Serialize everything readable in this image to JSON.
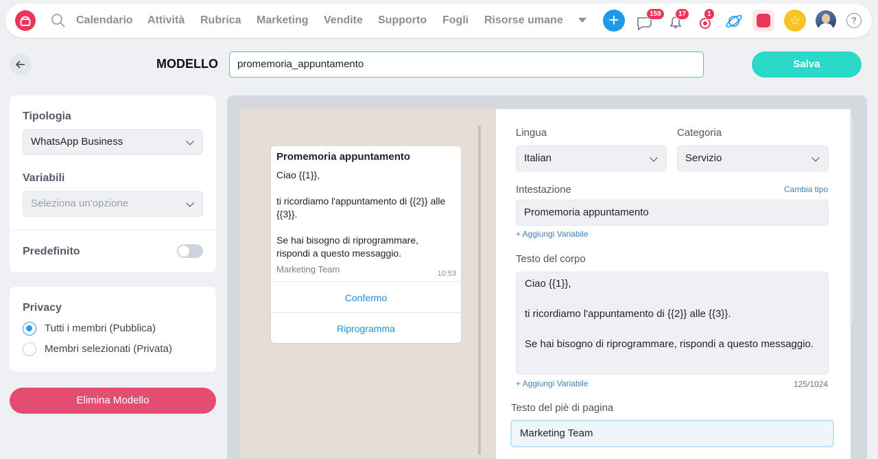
{
  "nav": {
    "menu": [
      "Calendario",
      "Attività",
      "Rubrica",
      "Marketing",
      "Vendite",
      "Supporto",
      "Fogli",
      "Risorse umane"
    ],
    "badges": {
      "chat": "159",
      "notifications": "17",
      "activity": "1"
    },
    "help": "?"
  },
  "header": {
    "title": "MODELLO",
    "template_name": "promemoria_appuntamento",
    "save_label": "Salva"
  },
  "left": {
    "tipologia_label": "Tipologia",
    "tipologia_value": "WhatsApp Business",
    "variabili_label": "Variabili",
    "variabili_placeholder": "Seleziona un'opzione",
    "predefinito_label": "Predefinito",
    "predefinito_on": false,
    "privacy_label": "Privacy",
    "privacy_options": [
      "Tutti i membri (Pubblica)",
      "Membri selezionati (Privata)"
    ],
    "privacy_selected": 0,
    "delete_label": "Elimina Modello"
  },
  "preview": {
    "title": "Promemoria appuntamento",
    "lines": [
      "Ciao {{1}},",
      "ti ricordiamo l'appuntamento di {{2}} alle",
      "{{3}}.",
      "Se hai bisogno di riprogrammare,",
      "rispondi a questo messaggio."
    ],
    "footer": "Marketing Team",
    "time": "10:53",
    "buttons": [
      "Confermo",
      "Riprogramma"
    ]
  },
  "form": {
    "lingua_label": "Lingua",
    "lingua_value": "Italian",
    "categoria_label": "Categoria",
    "categoria_value": "Servizio",
    "intestazione_label": "Intestazione",
    "cambia_tipo": "Cambia tipo",
    "intestazione_value": "Promemoria appuntamento",
    "add_variable": "+ Aggiungi Variabile",
    "corpo_label": "Testo del corpo",
    "corpo_lines": [
      "Ciao {{1}},",
      "ti ricordiamo l'appuntamento di {{2}} alle {{3}}.",
      "Se hai bisogno di riprogrammare, rispondi a questo messaggio."
    ],
    "counter": "125/1024",
    "footer_label": "Testo del piè di pagina",
    "footer_value": "Marketing Team"
  },
  "colors": {
    "brand": "#e9375a",
    "accent": "#2bd9c9",
    "link": "#1f8fd6"
  }
}
